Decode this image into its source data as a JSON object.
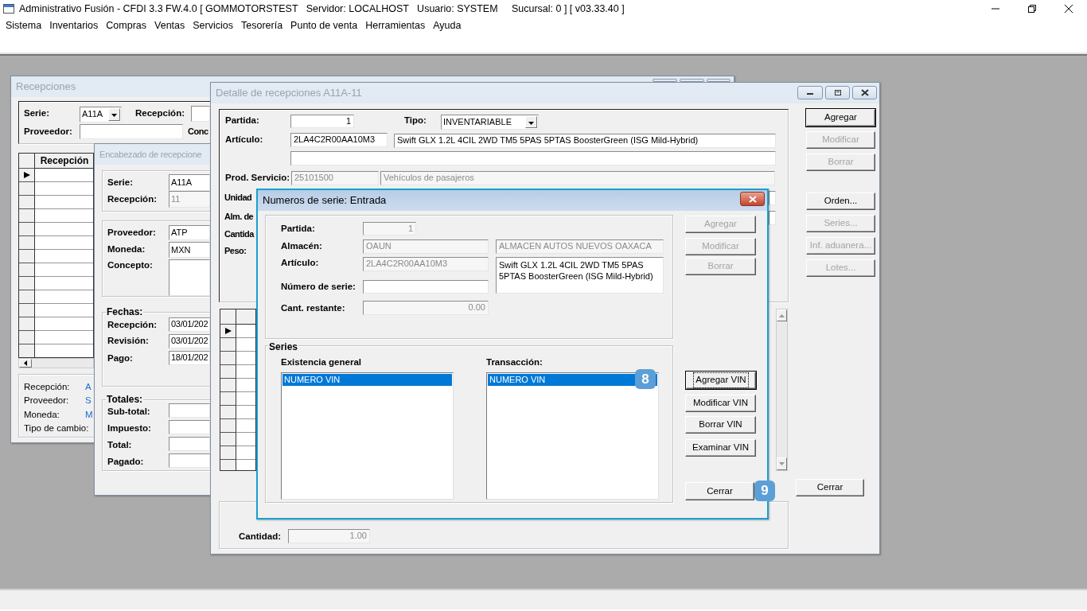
{
  "app": {
    "title": "Administrativo Fusión - CFDI 3.3 FW.4.0 [ GOMMOTORSTEST   Servidor: LOCALHOST   Usuario: SYSTEM     Sucursal: 0 ] [ v03.33.40 ]",
    "menu": [
      "Sistema",
      "Inventarios",
      "Compras",
      "Ventas",
      "Servicios",
      "Tesorería",
      "Punto de venta",
      "Herramientas",
      "Ayuda"
    ]
  },
  "recepciones": {
    "title": "Recepciones",
    "active": false,
    "labels": [
      "Serie:",
      "Recepción:",
      "Proveedor:",
      "Conc"
    ],
    "serie": "A11A",
    "grid": {
      "header": "Recepción",
      "rows": [
        {
          "current": true
        },
        {
          "current": false
        },
        {
          "current": false
        },
        {
          "current": false
        },
        {
          "current": false
        },
        {
          "current": false
        },
        {
          "current": false
        },
        {
          "current": false
        },
        {
          "current": false
        },
        {
          "current": false
        },
        {
          "current": false
        },
        {
          "current": false
        },
        {
          "current": false
        },
        {
          "current": false
        }
      ]
    },
    "info": [
      {
        "label": "Recepción:",
        "value": "A"
      },
      {
        "label": "Proveedor:",
        "value": "S"
      },
      {
        "label": "Moneda:",
        "value": "M"
      },
      {
        "label": "Tipo de cambio:"
      }
    ]
  },
  "encabezado": {
    "title": "Encabezado de recepcione",
    "active": false,
    "fields": [
      {
        "label": "Serie:",
        "value": "A11A",
        "disabled": false
      },
      {
        "label": "Recepción:",
        "value": "11",
        "disabled": true
      },
      {
        "label": "Proveedor:",
        "value": "ATP",
        "disabled": false
      },
      {
        "label": "Moneda:",
        "value": "MXN",
        "disabled": false
      },
      {
        "label": "Concepto:"
      }
    ],
    "fechas": {
      "legend": "Fechas:",
      "fields": [
        {
          "label": "Recepción:",
          "value": "03/01/202",
          "disabled": false
        },
        {
          "label": "Revisión:",
          "value": "03/01/202",
          "disabled": false
        },
        {
          "label": "Pago:",
          "value": "18/01/202",
          "disabled": false
        }
      ]
    },
    "totales": {
      "legend": "Totales:",
      "fields": [
        {
          "label": "Sub-total:"
        },
        {
          "label": "Impuesto:"
        },
        {
          "label": "Total:"
        },
        {
          "label": "Pagado:"
        }
      ]
    }
  },
  "detalle": {
    "title": "Detalle de recepciones A11A-11",
    "active": false,
    "partida": {
      "label": "Partida:",
      "value": "1",
      "disabled": false
    },
    "tipo": {
      "label": "Tipo:",
      "value": "INVENTARIABLE"
    },
    "articulo": {
      "label": "Artículo:",
      "code": "2LA4C2R00AA10M3",
      "description": "Swift GLX 1.2L 4CIL 2WD TM5 5PAS 5PTAS BoosterGreen (ISG Mild-Hybrid)",
      "disabled": false
    },
    "prod_servicio": {
      "label": "Prod. Servicio:",
      "code": "25101500",
      "description": "Vehículos de pasajeros",
      "disabled": true
    },
    "other_labels": [
      "Unidad",
      "Alm. de",
      "Cantida",
      "Peso:"
    ],
    "grid_rows": [
      {
        "current": true
      },
      {
        "current": false
      },
      {
        "current": false
      },
      {
        "current": false
      },
      {
        "current": false
      },
      {
        "current": false
      },
      {
        "current": false
      },
      {
        "current": false
      },
      {
        "current": false
      },
      {
        "current": false
      },
      {
        "current": false
      }
    ],
    "buttons": [
      {
        "label": "Agregar",
        "disabled": false,
        "default": true
      },
      {
        "label": "Modificar",
        "disabled": true,
        "default": false
      },
      {
        "label": "Borrar",
        "disabled": true,
        "default": false
      },
      {
        "label": "Orden...",
        "disabled": false,
        "default": false
      },
      {
        "label": "Series...",
        "disabled": true,
        "default": false
      },
      {
        "label": "Inf. aduanera...",
        "disabled": true,
        "default": false
      },
      {
        "label": "Lotes...",
        "disabled": true,
        "default": false
      }
    ],
    "close_button": "Cerrar",
    "cantidad": {
      "label": "Cantidad:",
      "value": "1.00",
      "disabled": true
    }
  },
  "dialog": {
    "title": "Numeros de serie: Entrada",
    "active": true,
    "fields": [
      {
        "label": "Partida:",
        "value": "1",
        "disabled": true
      },
      {
        "label": "Almacén:",
        "value": "OAUN",
        "disabled": true
      },
      {
        "label": "Artículo:",
        "value": "2LA4C2R00AA10M3",
        "disabled": true
      },
      {
        "label": "Número de serie:"
      },
      {
        "label": "Cant. restante:",
        "value": "0.00",
        "disabled": true
      }
    ],
    "almacen_name": "ALMACEN AUTOS NUEVOS OAXACA",
    "articulo_description": "Swift GLX 1.2L 4CIL 2WD TM5 5PAS 5PTAS BoosterGreen (ISG Mild-Hybrid)",
    "buttons": [
      {
        "label": "Agregar",
        "disabled": true
      },
      {
        "label": "Modificar",
        "disabled": true
      },
      {
        "label": "Borrar",
        "disabled": true
      }
    ],
    "series": {
      "legend": "Series",
      "lists": [
        {
          "heading": "Existencia general",
          "items": [
            {
              "text": "NUMERO VIN",
              "selected": true
            }
          ]
        },
        {
          "heading": "Transacción:",
          "items": [
            {
              "text": "NUMERO VIN",
              "selected": true
            }
          ]
        }
      ]
    },
    "vin_buttons": [
      {
        "label": "Agregar VIN",
        "focused": true
      },
      {
        "label": "Modificar VIN",
        "focused": false
      },
      {
        "label": "Borrar VIN",
        "focused": false
      },
      {
        "label": "Examinar VIN",
        "focused": false
      }
    ],
    "close_button": "Cerrar"
  },
  "step_marks": [
    "8",
    "9"
  ]
}
